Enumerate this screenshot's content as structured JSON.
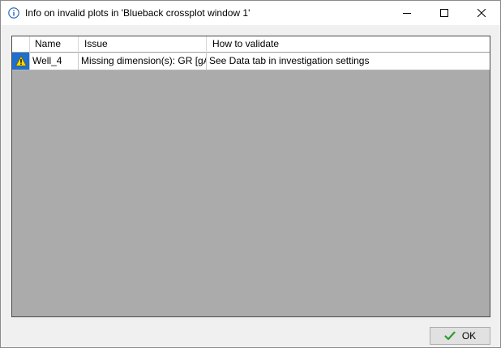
{
  "window": {
    "title": "Info on invalid plots in 'Blueback crossplot window 1'"
  },
  "grid": {
    "columns": [
      "Name",
      "Issue",
      "How to validate"
    ],
    "rows": [
      {
        "status_icon": "warning-icon",
        "name": "Well_4",
        "issue": "Missing dimension(s): GR [gAPI]",
        "how_to_validate": "See Data tab in investigation settings"
      }
    ]
  },
  "footer": {
    "ok_label": "OK"
  },
  "colors": {
    "row_icon_bg": "#1e6fd0",
    "warning_fill": "#f5d90a",
    "ok_check": "#2e9a2e",
    "empty_area": "#ababab"
  }
}
